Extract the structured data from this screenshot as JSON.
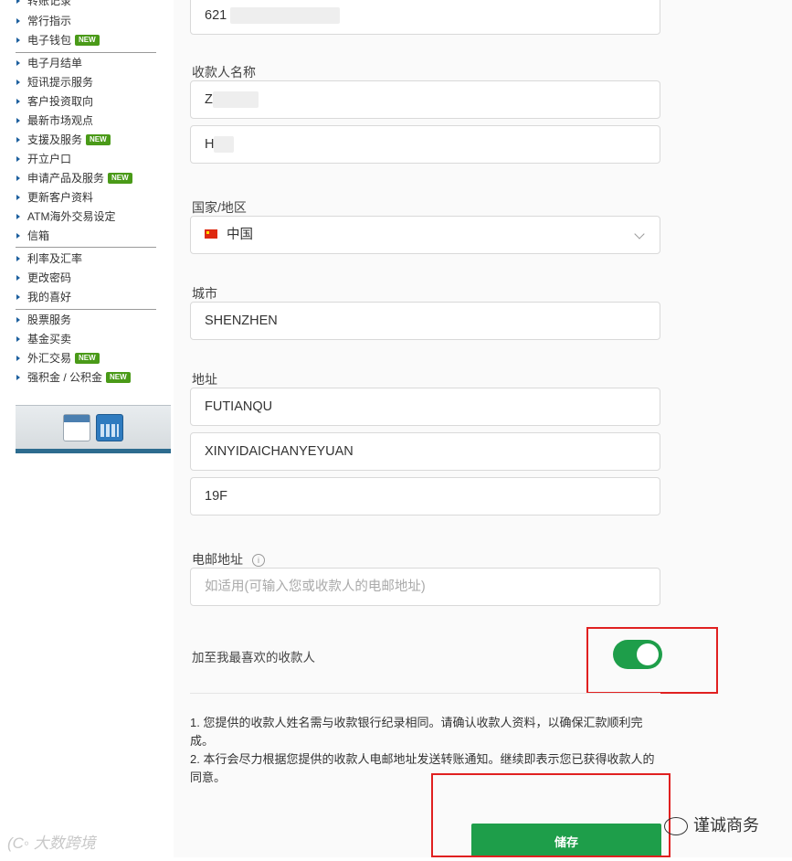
{
  "sidebar": {
    "top_partial": "转账记录",
    "group1": [
      {
        "label": "常行指示",
        "badge": ""
      },
      {
        "label": "电子钱包",
        "badge": "NEW"
      }
    ],
    "group2": [
      {
        "label": "电子月结单",
        "badge": ""
      },
      {
        "label": "短讯提示服务",
        "badge": ""
      },
      {
        "label": "客户投资取向",
        "badge": ""
      },
      {
        "label": "最新市场观点",
        "badge": ""
      },
      {
        "label": "支援及服务",
        "badge": "NEW"
      },
      {
        "label": "开立户口",
        "badge": ""
      },
      {
        "label": "申请产品及服务",
        "badge": "NEW"
      },
      {
        "label": "更新客户资料",
        "badge": ""
      },
      {
        "label": "ATM海外交易设定",
        "badge": ""
      },
      {
        "label": "信箱",
        "badge": ""
      }
    ],
    "group3": [
      {
        "label": "利率及汇率",
        "badge": ""
      },
      {
        "label": "更改密码",
        "badge": ""
      },
      {
        "label": "我的喜好",
        "badge": ""
      }
    ],
    "group4": [
      {
        "label": "股票服务",
        "badge": ""
      },
      {
        "label": "基金买卖",
        "badge": ""
      },
      {
        "label": "外汇交易",
        "badge": "NEW"
      },
      {
        "label": "强积金 / 公积金",
        "badge": "NEW"
      }
    ]
  },
  "form": {
    "account_number_visible": "621",
    "payee_name_label": "收款人名称",
    "payee_name_line1_visible": "Z",
    "payee_name_line2_visible": "H",
    "country_label": "国家/地区",
    "country_value": "中国",
    "city_label": "城市",
    "city_value": "SHENZHEN",
    "address_label": "地址",
    "address_line1": "FUTIANQU",
    "address_line2": "XINYIDAICHANYEYUAN",
    "address_line3": "19F",
    "email_label": "电邮地址",
    "email_placeholder": "如适用(可输入您或收款人的电邮地址)",
    "favorite_label": "加至我最喜欢的收款人",
    "favorite_on": true,
    "note1": "1. 您提供的收款人姓名需与收款银行纪录相同。请确认收款人资料，以确保汇款顺利完成。",
    "note2": "2. 本行会尽力根据您提供的收款人电邮地址发送转账通知。继续即表示您已获得收款人的同意。",
    "save_label": "储存"
  },
  "watermarks": {
    "right": "谨诚商务",
    "left": "大数跨境"
  },
  "colors": {
    "accent_green": "#1e9e4a",
    "badge_green": "#4a9a18",
    "highlight_red": "#e02020"
  }
}
